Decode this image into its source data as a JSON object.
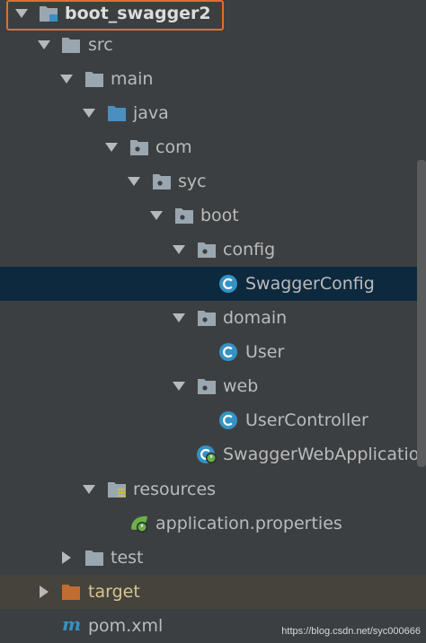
{
  "project_tree": {
    "items": [
      {
        "label": "boot_swagger2",
        "kind": "module",
        "expanded": true
      },
      {
        "label": "src",
        "kind": "folder",
        "expanded": true
      },
      {
        "label": "main",
        "kind": "folder",
        "expanded": true
      },
      {
        "label": "java",
        "kind": "source-folder",
        "expanded": true
      },
      {
        "label": "com",
        "kind": "package",
        "expanded": true
      },
      {
        "label": "syc",
        "kind": "package",
        "expanded": true
      },
      {
        "label": "boot",
        "kind": "package",
        "expanded": true
      },
      {
        "label": "config",
        "kind": "package",
        "expanded": true
      },
      {
        "label": "SwaggerConfig",
        "kind": "class",
        "selected": true
      },
      {
        "label": "domain",
        "kind": "package",
        "expanded": true
      },
      {
        "label": "User",
        "kind": "class"
      },
      {
        "label": "web",
        "kind": "package",
        "expanded": true
      },
      {
        "label": "UserController",
        "kind": "class"
      },
      {
        "label": "SwaggerWebApplication",
        "kind": "spring-boot-class"
      },
      {
        "label": "resources",
        "kind": "resources-folder",
        "expanded": true
      },
      {
        "label": "application.properties",
        "kind": "spring-properties"
      },
      {
        "label": "test",
        "kind": "folder",
        "expanded": false
      },
      {
        "label": "target",
        "kind": "excluded-folder",
        "expanded": false
      },
      {
        "label": "pom.xml",
        "kind": "maven-file"
      }
    ]
  },
  "watermark": "https://blog.csdn.net/syc000666",
  "colors": {
    "background": "#3c3f41",
    "selected_row": "#0d293e",
    "excluded_row": "#46433c",
    "text": "#bbbbbb",
    "highlight_border": "#e06e2e",
    "class_icon": "#3592c4",
    "folder": "#9aa7b0",
    "source_folder": "#4a8fc0",
    "excluded_folder": "#c16c30",
    "spring_green": "#6ab04c"
  }
}
